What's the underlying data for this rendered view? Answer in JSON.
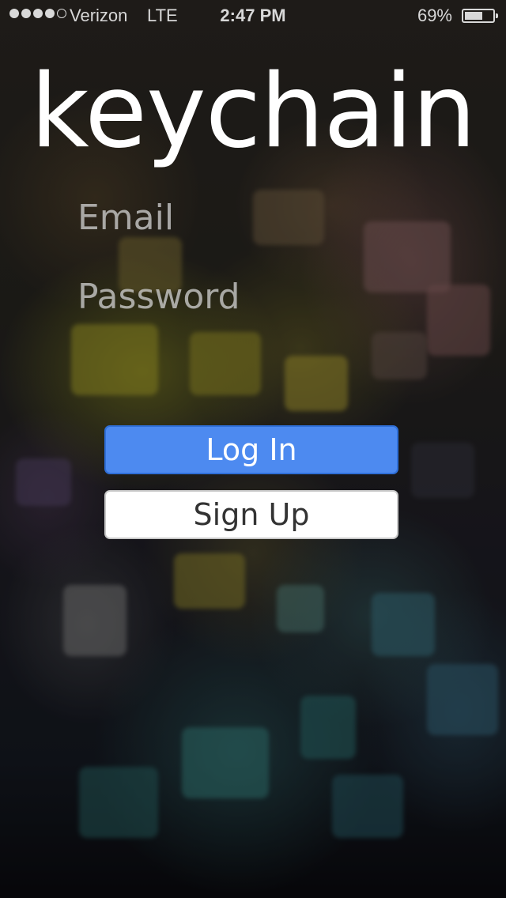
{
  "status_bar": {
    "carrier": "Verizon",
    "network": "LTE",
    "time": "2:47 PM",
    "battery_percent": "69%",
    "battery_level": 0.69,
    "signal_bars_filled": 4,
    "signal_bars_total": 5
  },
  "app": {
    "title": "keychain"
  },
  "form": {
    "email_placeholder": "Email",
    "password_placeholder": "Password",
    "email_value": "",
    "password_value": ""
  },
  "actions": {
    "login_label": "Log In",
    "signup_label": "Sign Up"
  },
  "colors": {
    "login_button": "#4d8af0",
    "signup_button": "#ffffff",
    "title_text": "#ffffff"
  },
  "background": {
    "description_icon": "padlocks-photo-background"
  }
}
